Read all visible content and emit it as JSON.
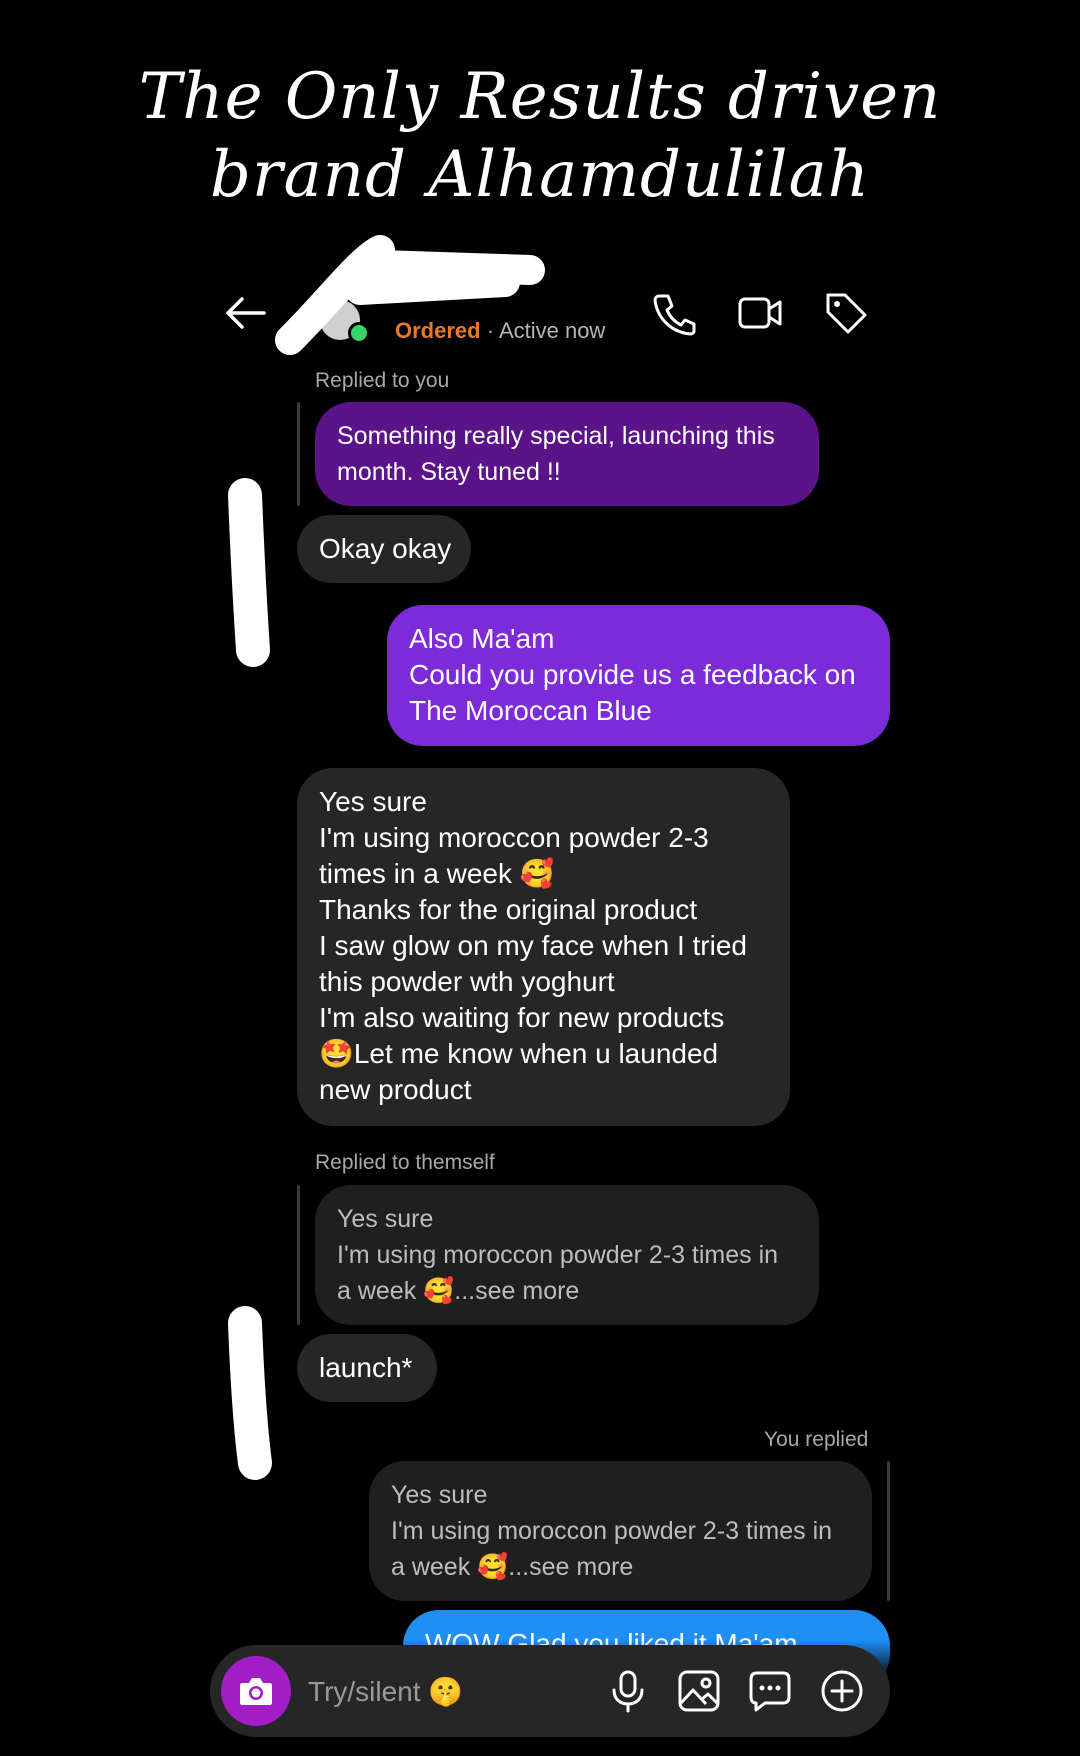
{
  "caption": {
    "line1": "The Only Results driven",
    "line2": "brand Alhamdulilah"
  },
  "header": {
    "status_tag": "Ordered",
    "separator": " · ",
    "activity": "Active now",
    "icons": [
      "back-arrow-icon",
      "phone-icon",
      "video-icon",
      "tag-icon"
    ]
  },
  "thread": {
    "reply1_meta": "Replied to you",
    "reply1_quote": [
      "Something really special, launching this",
      "month. Stay tuned !!"
    ],
    "msg_okay": "Okay okay",
    "msg_ask": [
      "Also Ma'am",
      "Could you provide us a feedback on",
      "The Moroccan Blue"
    ],
    "msg_feedback": [
      "Yes sure",
      "I'm using moroccon powder 2-3",
      "times in a week 🥰",
      "Thanks for the original product",
      "I saw glow on my face when I tried",
      "this powder wth yoghurt",
      "I'm also waiting for new products",
      "🤩Let me know when u launded",
      "new product"
    ],
    "reply2_meta": "Replied to themself",
    "reply2_quote": [
      "Yes sure",
      "I'm using moroccon powder 2-3 times in",
      "a week 🥰...see more"
    ],
    "msg_launch": "launch*",
    "reply3_meta": "You replied",
    "reply3_quote": [
      "Yes sure",
      "I'm using moroccon powder 2-3 times in",
      "a week 🥰...see more"
    ],
    "msg_wow": "WOW Glad you liked it Ma'am"
  },
  "composer": {
    "placeholder": "Try/silent 🤫",
    "icons": [
      "camera-icon",
      "microphone-icon",
      "image-icon",
      "sticker-chat-icon",
      "plus-icon"
    ]
  },
  "colors": {
    "background": "#000000",
    "incoming_bubble": "#262626",
    "outgoing_purple": "#7d2ad8",
    "quoted_purple": "#5a1388",
    "outgoing_blue": "#1f8ef5",
    "ordered_tag": "#e8782a",
    "online_dot": "#3ad26b",
    "camera_button": "#a11ec6"
  }
}
